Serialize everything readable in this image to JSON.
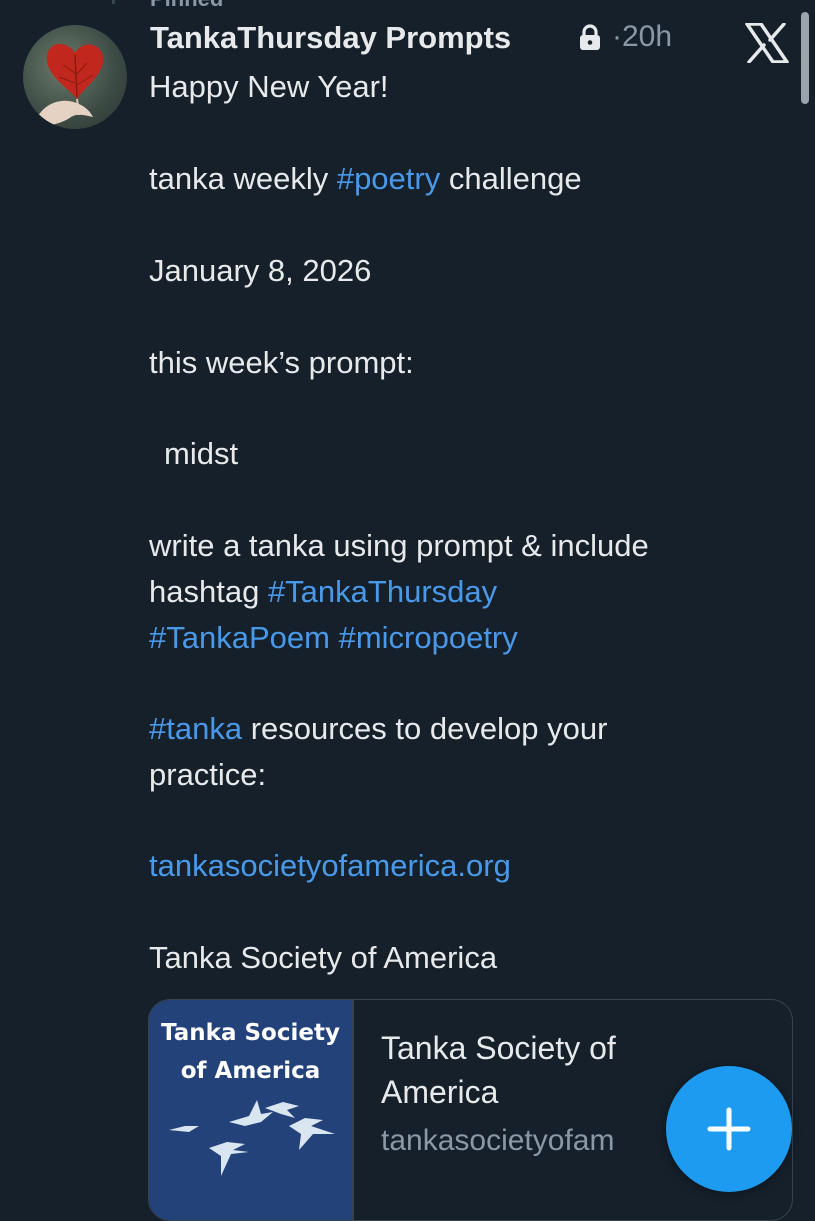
{
  "pinned": {
    "label": "Pinned"
  },
  "post": {
    "author_name": "TankaThursday Prompts",
    "time": "20h",
    "lines": {
      "greeting": "Happy New Year!",
      "challenge_pre": "tanka weekly ",
      "challenge_tag": "#poetry",
      "challenge_post": " challenge",
      "date": "January 8, 2026",
      "prompt_intro": "this week’s prompt:",
      "prompt_word": "midst",
      "instruction": "write a tanka using prompt & include",
      "hashtag_word": "hashtag ",
      "tag_thursday": "#TankaThursday",
      "tag_poem": "#TankaPoem",
      "tag_micro": "#micropoetry",
      "tag_tanka": "#tanka",
      "resources": " resources to develop your",
      "practice": "practice:",
      "link": "tankasocietyofamerica.org",
      "org_name": "Tanka Society of America"
    }
  },
  "link_card": {
    "image_title_line1": "Tanka Society",
    "image_title_line2": "of America",
    "title": "Tanka Society of America",
    "domain": "tankasocietyofam"
  },
  "icons": {
    "lock": "lock-icon",
    "x_logo": "x-logo-icon",
    "compose": "plus-icon"
  },
  "colors": {
    "background": "#15202b",
    "text": "#e7e9ea",
    "secondary": "#8b98a5",
    "link": "#4a99e9",
    "fab": "#1d9bf0",
    "card_image": "#24427a"
  }
}
